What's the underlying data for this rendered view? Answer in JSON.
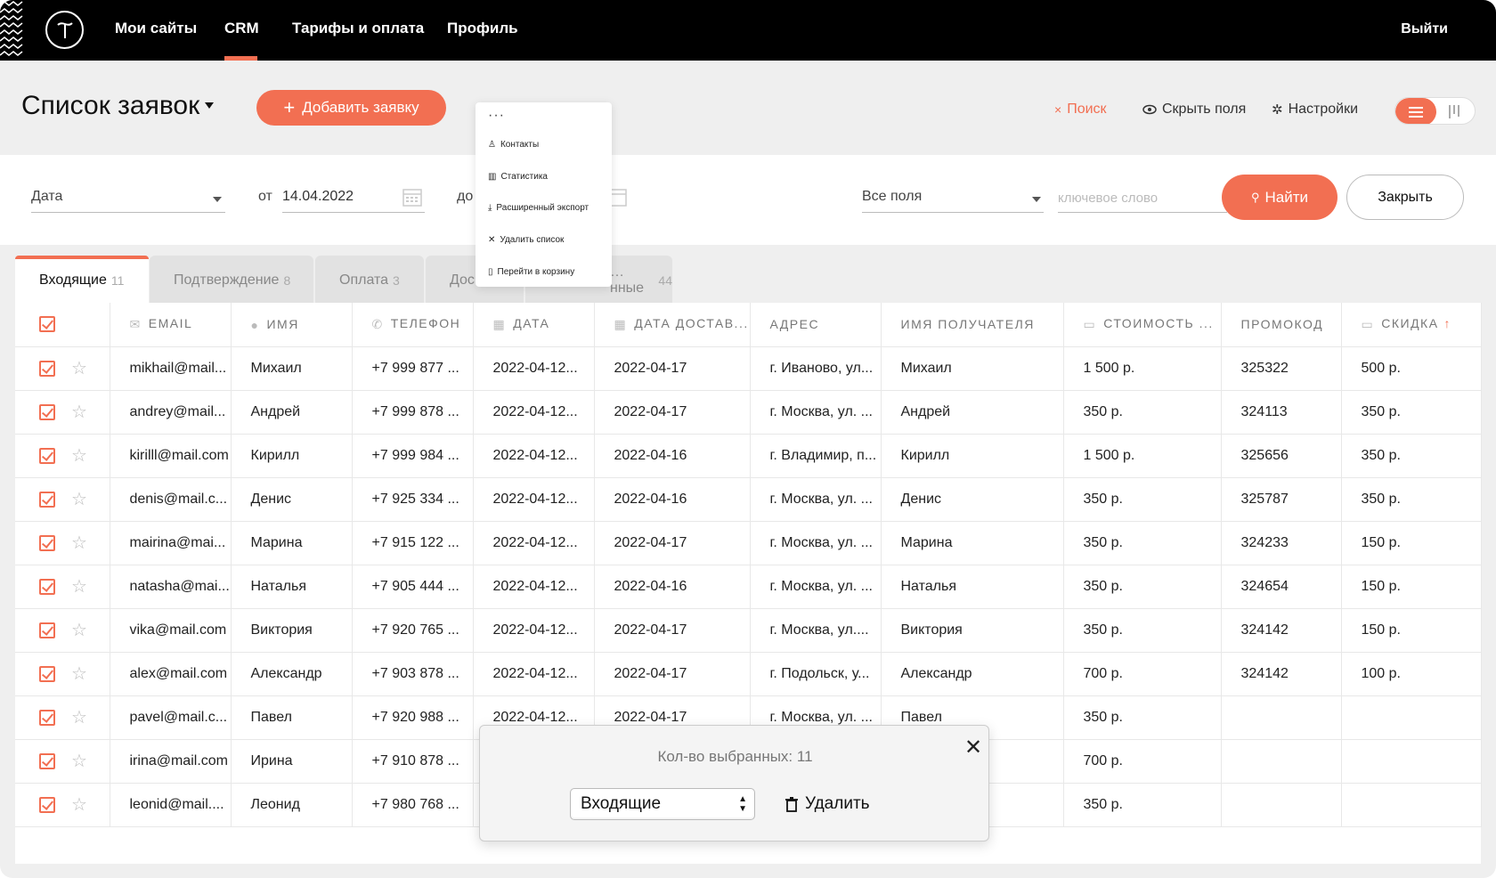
{
  "nav": {
    "links": [
      "Мои сайты",
      "CRM",
      "Тарифы и оплата",
      "Профиль"
    ],
    "active": "CRM",
    "logout": "Выйти"
  },
  "header": {
    "title": "Список заявок",
    "add_button": "Добавить заявку",
    "search": "Поиск",
    "hide_fields": "Скрыть поля",
    "settings": "Настройки"
  },
  "filters": {
    "date_field": "Дата",
    "from_label": "от",
    "from_value": "14.04.2022",
    "to_label": "до",
    "fields_select": "Все поля",
    "keyword_placeholder": "ключевое слово",
    "find_button": "Найти",
    "close_button": "Закрыть"
  },
  "more_menu": {
    "dots": "···",
    "items": [
      "Контакты",
      "Статистика",
      "Расширенный экспорт",
      "Удалить список",
      "Перейти в корзину"
    ]
  },
  "tabs": [
    {
      "label": "Входящие",
      "count": "11"
    },
    {
      "label": "Подтверждение",
      "count": "8"
    },
    {
      "label": "Оплата",
      "count": "3"
    },
    {
      "label": "Дос",
      "count": ""
    },
    {
      "label": "…нные",
      "count": "44"
    }
  ],
  "table": {
    "columns": [
      "EMAIL",
      "ИМЯ",
      "ТЕЛЕФОН",
      "ДАТА",
      "ДАТА ДОСТАВ...",
      "АДРЕС",
      "ИМЯ ПОЛУЧАТЕЛЯ",
      "СТОИМОСТЬ ...",
      "ПРОМОКОД",
      "СКИДКА"
    ],
    "rows": [
      [
        "mikhail@mail...",
        "Михаил",
        "+7 999 877 ...",
        "2022-04-12...",
        "2022-04-17",
        "г. Иваново, ул...",
        "Михаил",
        "1 500 р.",
        "325322",
        "500 р."
      ],
      [
        "andrey@mail...",
        "Андрей",
        "+7 999 878 ...",
        "2022-04-12...",
        "2022-04-17",
        "г. Москва, ул. ...",
        "Андрей",
        "350 р.",
        "324113",
        "350 р."
      ],
      [
        "kirilll@mail.com",
        "Кирилл",
        "+7 999 984 ...",
        "2022-04-12...",
        "2022-04-16",
        "г. Владимир, п...",
        "Кирилл",
        "1 500 р.",
        "325656",
        "350 р."
      ],
      [
        "denis@mail.c...",
        "Денис",
        "+7 925 334 ...",
        "2022-04-12...",
        "2022-04-16",
        "г. Москва, ул. ...",
        "Денис",
        "350 р.",
        "325787",
        "350 р."
      ],
      [
        "mairina@mai...",
        "Марина",
        "+7 915 122 ...",
        "2022-04-12...",
        "2022-04-17",
        "г. Москва, ул. ...",
        "Марина",
        "350 р.",
        "324233",
        "150 р."
      ],
      [
        "natasha@mai...",
        "Наталья",
        "+7 905 444 ...",
        "2022-04-12...",
        "2022-04-16",
        "г. Москва, ул. ...",
        "Наталья",
        "350 р.",
        "324654",
        "150 р."
      ],
      [
        "vika@mail.com",
        "Виктория",
        "+7 920 765 ...",
        "2022-04-12...",
        "2022-04-17",
        "г. Москва, ул....",
        "Виктория",
        "350 р.",
        "324142",
        "150 р."
      ],
      [
        "alex@mail.com",
        "Александр",
        "+7 903 878 ...",
        "2022-04-12...",
        "2022-04-17",
        "г. Подольск, у...",
        "Александр",
        "700 р.",
        "324142",
        "100 р."
      ],
      [
        "pavel@mail.c...",
        "Павел",
        "+7 920 988 ...",
        "2022-04-12...",
        "2022-04-17",
        "г. Москва, ул. ...",
        "Павел",
        "350 р.",
        "",
        ""
      ],
      [
        "irina@mail.com",
        "Ирина",
        "+7 910 878 ...",
        "",
        "",
        "",
        "",
        "700 р.",
        "",
        ""
      ],
      [
        "leonid@mail....",
        "Леонид",
        "+7 980 768 ...",
        "",
        "",
        "",
        "",
        "350 р.",
        "",
        ""
      ]
    ]
  },
  "popup": {
    "count_text": "Кол-во выбранных: 11",
    "select_value": "Входящие",
    "delete_label": "Удалить"
  },
  "colors": {
    "accent": "#f26f52",
    "nav_bg": "#000000"
  }
}
